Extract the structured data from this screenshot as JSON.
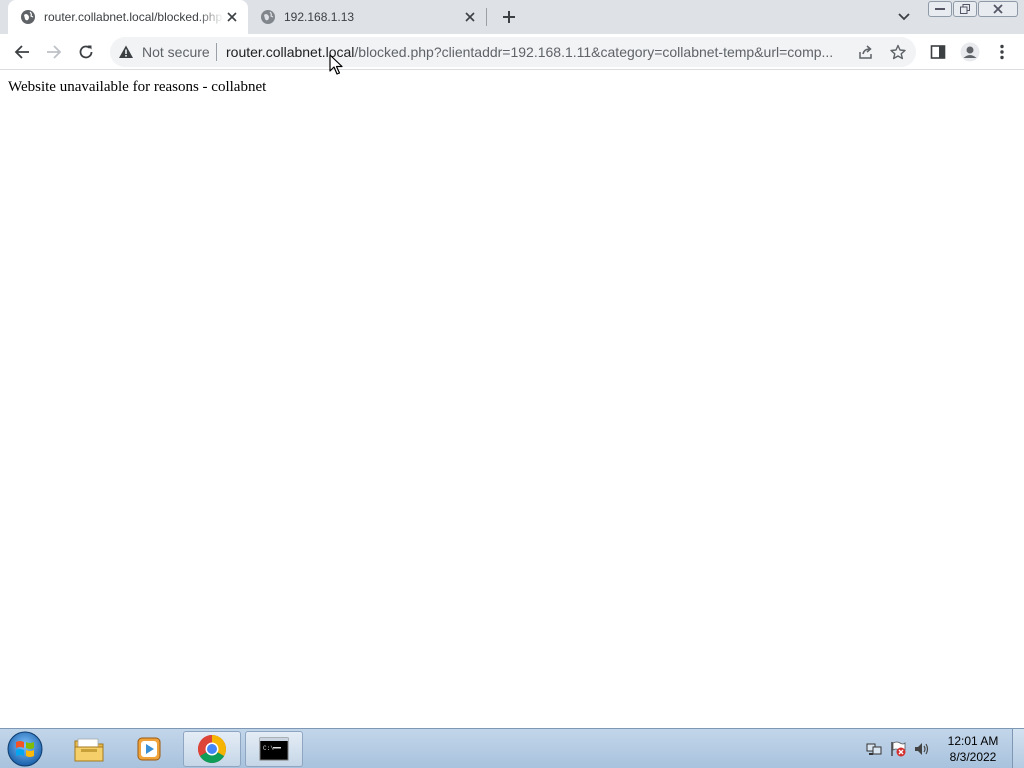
{
  "browser": {
    "tabs": [
      {
        "title": "router.collabnet.local/blocked.php",
        "active": true,
        "favicon": "globe-icon"
      },
      {
        "title": "192.168.1.13",
        "active": false,
        "favicon": "globe-icon"
      }
    ],
    "omnibox": {
      "security_label": "Not secure",
      "url_host": "router.collabnet.local",
      "url_rest": "/blocked.php?clientaddr=192.168.1.11&category=collabnet-temp&url=comp..."
    }
  },
  "page": {
    "message": "Website unavailable for reasons - collabnet"
  },
  "taskbar": {
    "clock_time": "12:01 AM",
    "clock_date": "8/3/2022"
  },
  "colors": {
    "tabstrip_bg": "#dee1e6",
    "omnibox_bg": "#f1f3f4",
    "chrome_red": "#db4437",
    "chrome_green": "#0f9d58",
    "chrome_yellow": "#f4b400",
    "chrome_blue": "#4285f4"
  }
}
